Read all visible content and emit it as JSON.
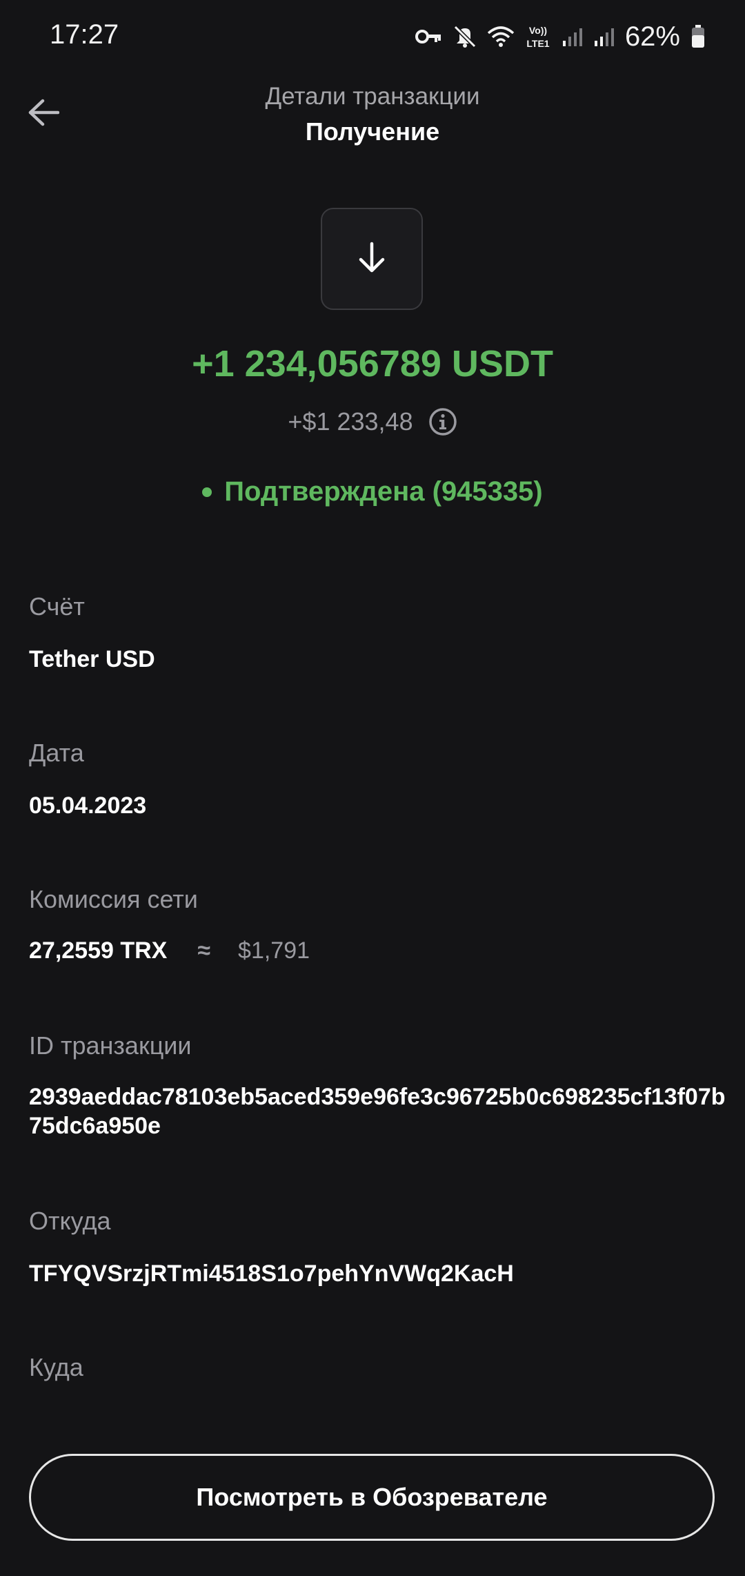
{
  "status_bar": {
    "time": "17:27",
    "battery_percent": "62%",
    "icons": [
      "vpn-key-icon",
      "mute-icon",
      "wifi-icon",
      "volte-icon",
      "signal-icon",
      "signal-icon",
      "battery-icon"
    ],
    "volte_label_top": "Vo))",
    "volte_label_bottom": "LTE1"
  },
  "header": {
    "title": "Детали транзакции",
    "subtitle": "Получение",
    "back_icon": "arrow-left-icon"
  },
  "transaction": {
    "direction_icon": "arrow-down-icon",
    "amount": "+1 234,056789 USDT",
    "fiat_amount": "+$1 233,48",
    "status": "Подтверждена (945335)",
    "colors": {
      "positive": "#5fb85f",
      "background": "#141416",
      "muted": "#9a9aa0"
    }
  },
  "fields": {
    "account": {
      "label": "Счёт",
      "value": "Tether USD"
    },
    "date": {
      "label": "Дата",
      "value": "05.04.2023"
    },
    "fee": {
      "label": "Комиссия сети",
      "value": "27,2559 TRX",
      "approx": "≈",
      "fiat": "$1,791"
    },
    "tx_id": {
      "label": "ID транзакции",
      "value": "2939aeddac78103eb5aced359e96fe3c96725b0c698235cf13f07b75dc6a950e"
    },
    "from": {
      "label": "Откуда",
      "value": "TFYQVSrzjRTmi4518S1o7pehYnVWq2KacH"
    },
    "to": {
      "label": "Куда"
    }
  },
  "actions": {
    "explorer_button": "Посмотреть в Обозревателе"
  }
}
